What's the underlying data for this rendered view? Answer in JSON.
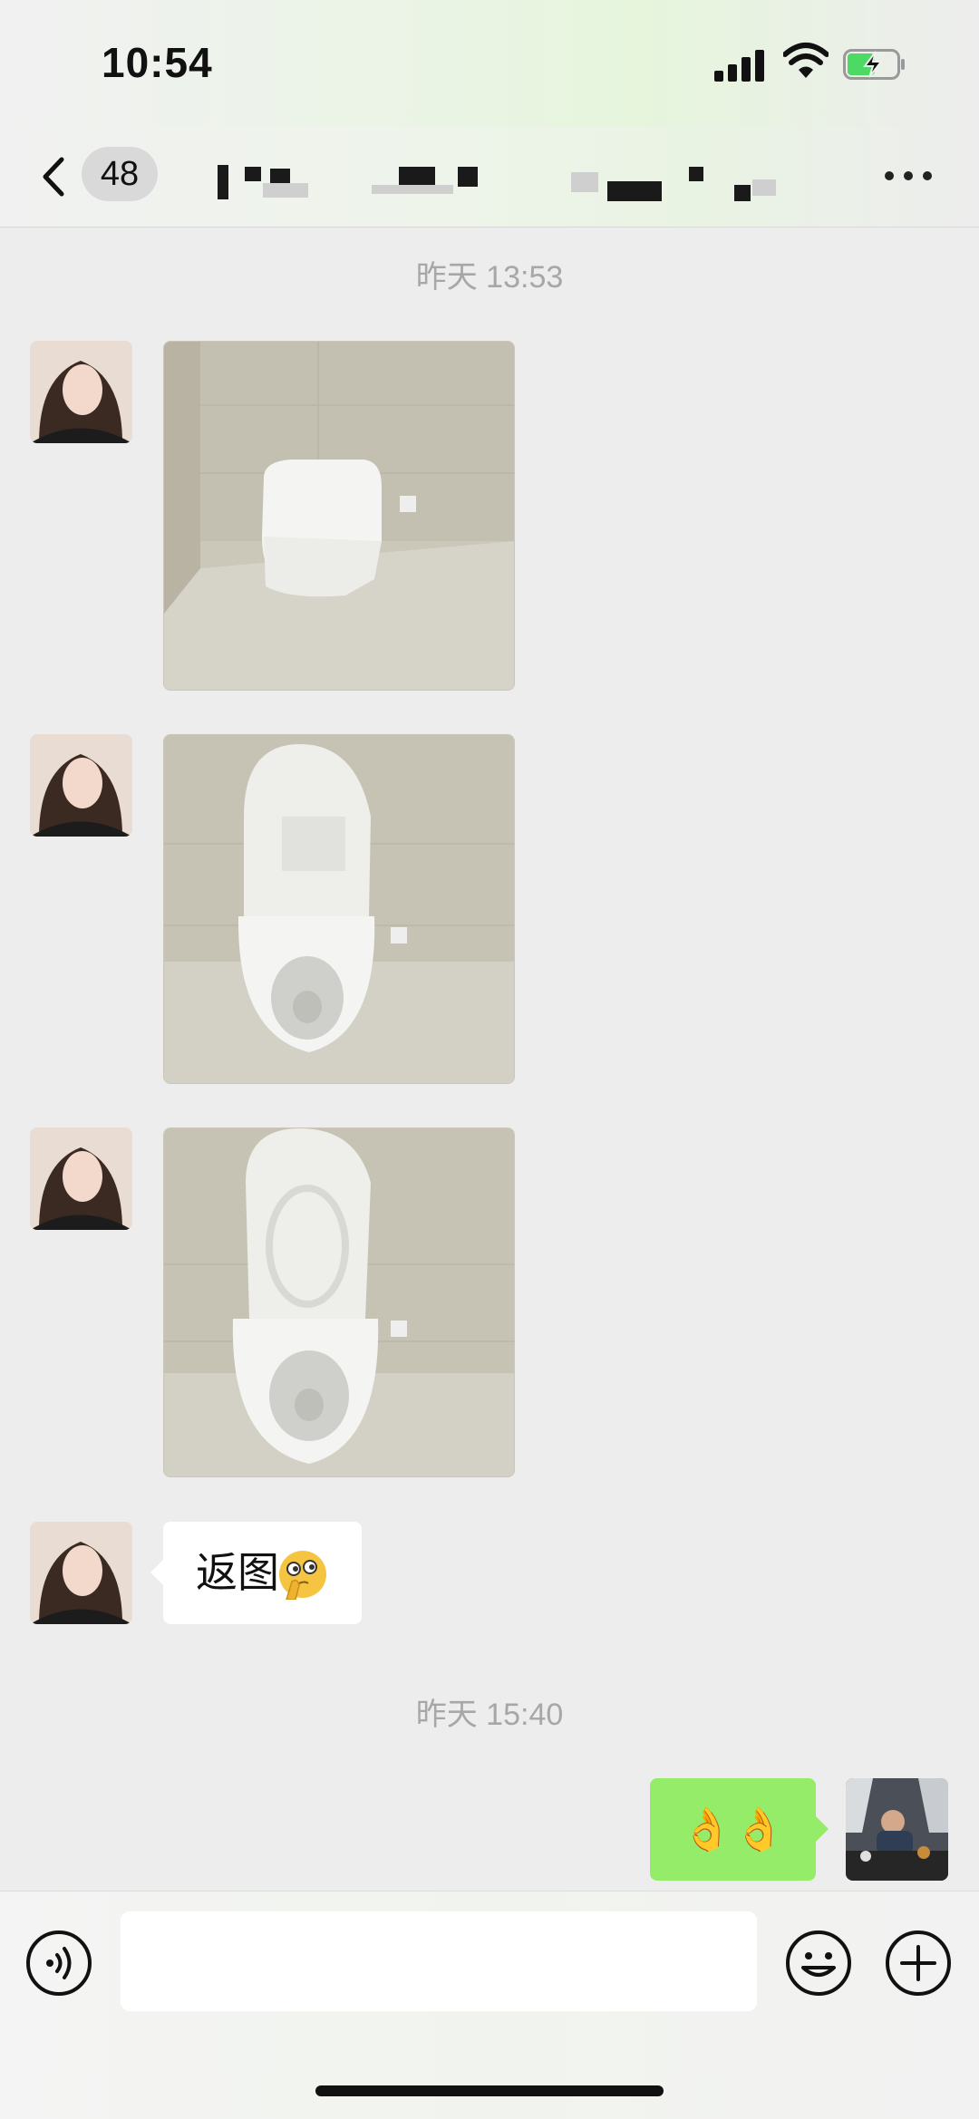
{
  "status_bar": {
    "time": "10:54"
  },
  "header": {
    "unread_count": "48",
    "more_label": "..."
  },
  "messages": {
    "timestamp_1": "昨天 13:53",
    "text_message": "返图",
    "timestamp_2": "昨天 15:40",
    "reply_emoji": "👌👌"
  },
  "input_bar": {
    "placeholder": ""
  },
  "colors": {
    "outgoing_bubble": "#95ec69",
    "background": "#ededed",
    "incoming_bubble": "#ffffff"
  }
}
